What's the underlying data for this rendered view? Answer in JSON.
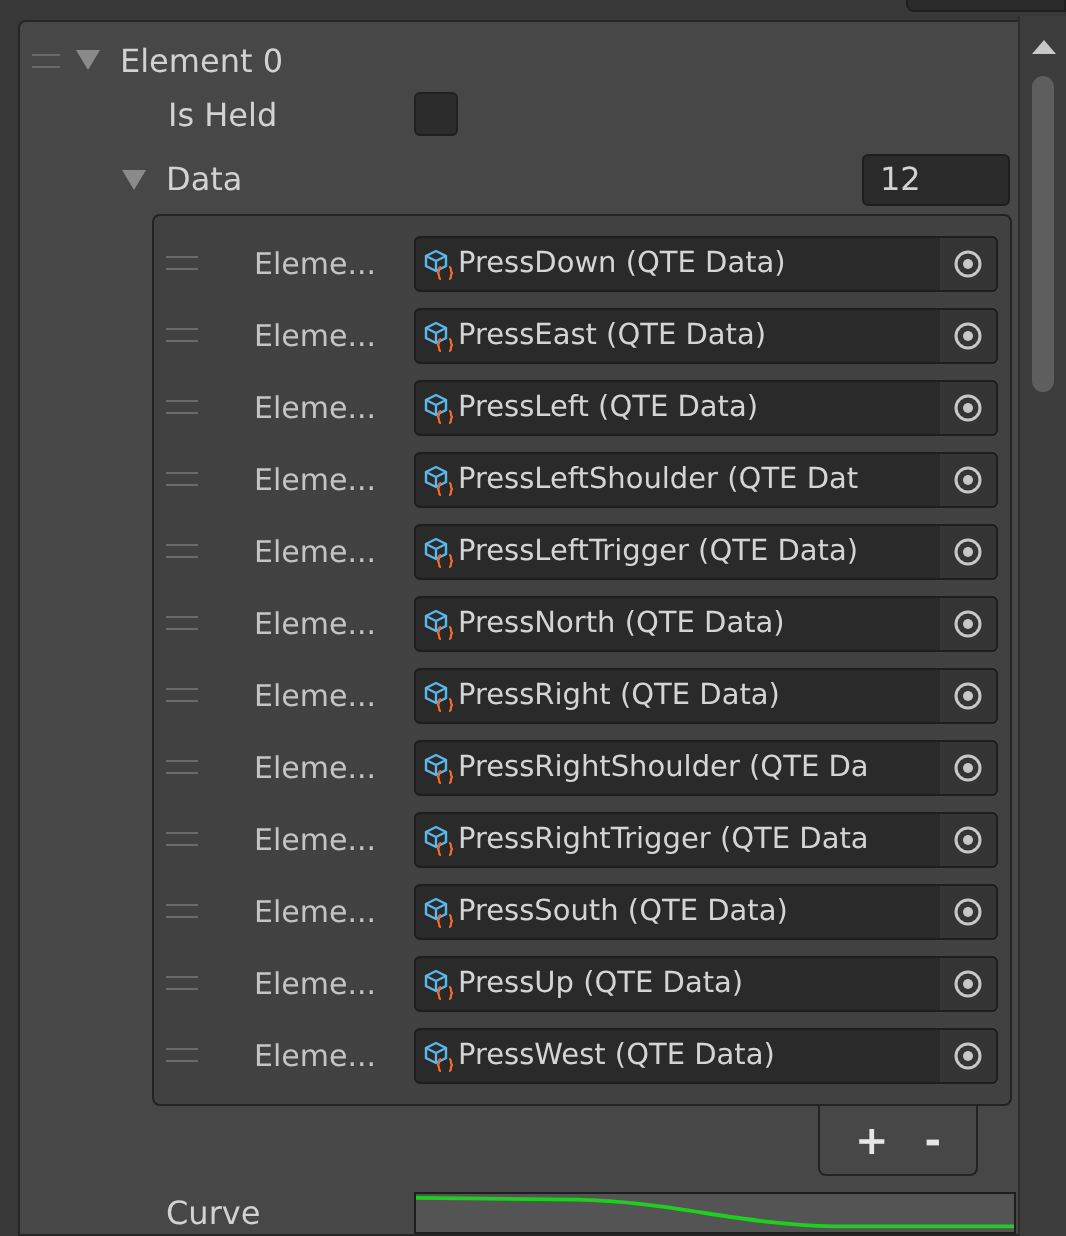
{
  "element": {
    "label": "Element 0",
    "expanded": true
  },
  "is_held": {
    "label": "Is Held",
    "checked": false
  },
  "data": {
    "label": "Data",
    "expanded": true,
    "size": "12",
    "items": [
      {
        "label": "Eleme...",
        "value": "PressDown (QTE Data)"
      },
      {
        "label": "Eleme...",
        "value": "PressEast (QTE Data)"
      },
      {
        "label": "Eleme...",
        "value": "PressLeft (QTE Data)"
      },
      {
        "label": "Eleme...",
        "value": "PressLeftShoulder (QTE Dat"
      },
      {
        "label": "Eleme...",
        "value": "PressLeftTrigger (QTE Data)"
      },
      {
        "label": "Eleme...",
        "value": "PressNorth (QTE Data)"
      },
      {
        "label": "Eleme...",
        "value": "PressRight (QTE Data)"
      },
      {
        "label": "Eleme...",
        "value": "PressRightShoulder (QTE Da"
      },
      {
        "label": "Eleme...",
        "value": "PressRightTrigger (QTE Data"
      },
      {
        "label": "Eleme...",
        "value": "PressSouth (QTE Data)"
      },
      {
        "label": "Eleme...",
        "value": "PressUp (QTE Data)"
      },
      {
        "label": "Eleme...",
        "value": "PressWest (QTE Data)"
      }
    ],
    "add": "+",
    "remove": "-"
  },
  "curve": {
    "label": "Curve"
  }
}
